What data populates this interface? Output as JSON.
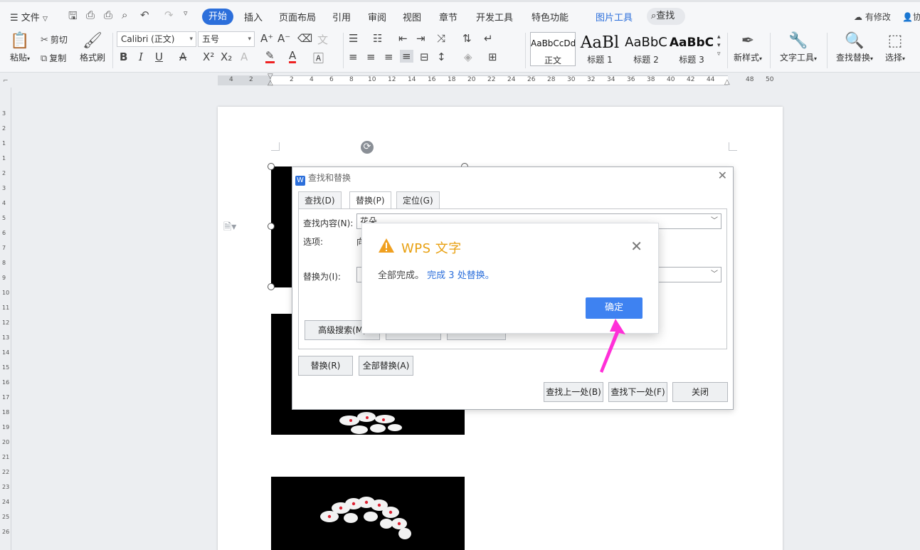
{
  "menu": {
    "file": "文件",
    "tabs": [
      "开始",
      "插入",
      "页面布局",
      "引用",
      "审阅",
      "视图",
      "章节",
      "开发工具",
      "特色功能"
    ],
    "picture_tools": "图片工具",
    "search": "查找",
    "has_changes": "有修改",
    "collab": "协"
  },
  "toolbar": {
    "paste": "粘贴",
    "cut": "剪切",
    "copy": "复制",
    "format_painter": "格式刷",
    "font_name": "Calibri (正文)",
    "font_size": "五号",
    "styles": [
      {
        "sample": "AaBbCcDd",
        "label": "正文"
      },
      {
        "sample": "AaBl",
        "label": "标题 1"
      },
      {
        "sample": "AaBbC",
        "label": "标题 2"
      },
      {
        "sample": "AaBbC",
        "label": "标题 3"
      }
    ],
    "new_style": "新样式",
    "text_tools": "文字工具",
    "find_replace": "查找替换",
    "select": "选择"
  },
  "ruler": {
    "h_numbers": [
      "4",
      "2",
      "2",
      "4",
      "6",
      "8",
      "10",
      "12",
      "14",
      "16",
      "18",
      "20",
      "22",
      "24",
      "26",
      "28",
      "30",
      "32",
      "34",
      "36",
      "38",
      "40",
      "42",
      "44",
      "48",
      "50"
    ],
    "v_numbers": [
      "3",
      "2",
      "1",
      "1",
      "2",
      "3",
      "4",
      "5",
      "6",
      "7",
      "8",
      "9",
      "10",
      "11",
      "12",
      "13",
      "14",
      "15",
      "16",
      "17",
      "18",
      "19",
      "20",
      "21",
      "22",
      "23",
      "24",
      "25",
      "26"
    ]
  },
  "find_replace": {
    "title": "查找和替换",
    "tab_find": "查找(D)",
    "tab_replace": "替换(P)",
    "tab_goto": "定位(G)",
    "find_label": "查找内容(N):",
    "find_value": "花朵",
    "options_label": "选项:",
    "options_value": "向",
    "replace_label": "替换为(I):",
    "advanced": "高级搜索(M)",
    "replace_btn": "替换(R)",
    "replace_all_btn": "全部替换(A)",
    "find_prev": "查找上一处(B)",
    "find_next": "查找下一处(F)",
    "close": "关闭"
  },
  "alert": {
    "title": "WPS 文字",
    "msg_prefix": "全部完成。",
    "msg_highlight": "完成 3 处替换。",
    "ok": "确定",
    "warn_color": "#f0a020",
    "button_color": "#3e82f1",
    "arrow_color": "#ff2fd8"
  }
}
